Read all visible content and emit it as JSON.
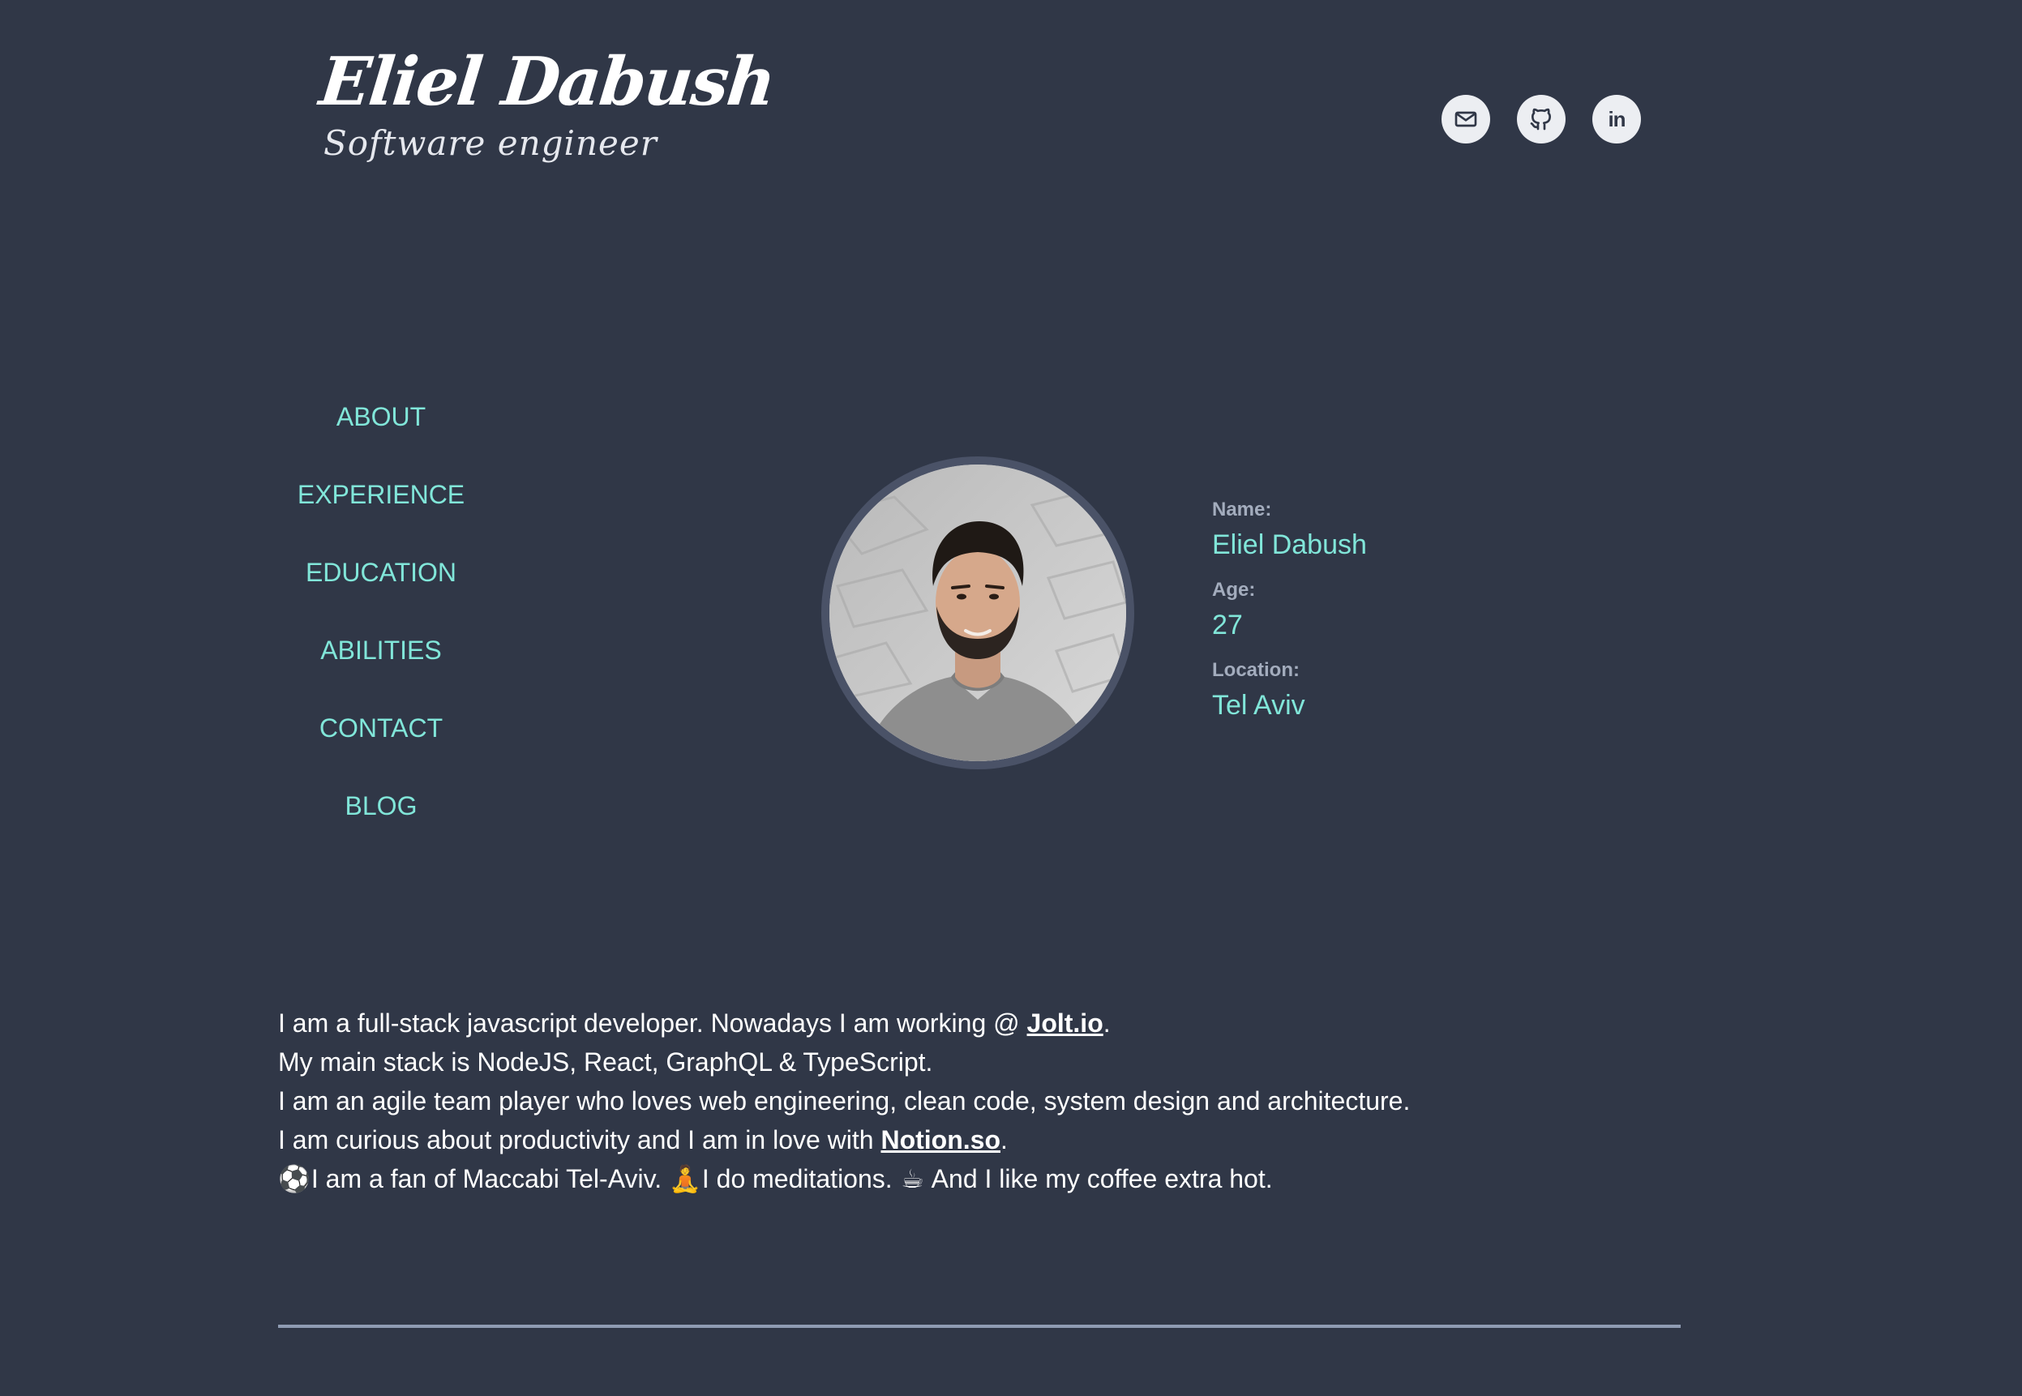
{
  "header": {
    "name": "Eliel Dabush",
    "tagline": "Software engineer"
  },
  "social": [
    {
      "name": "email",
      "icon": "mail-icon"
    },
    {
      "name": "github",
      "icon": "github-icon"
    },
    {
      "name": "linkedin",
      "icon": "linkedin-icon",
      "label": "in"
    }
  ],
  "nav": {
    "items": [
      "ABOUT",
      "EXPERIENCE",
      "EDUCATION",
      "ABILITIES",
      "CONTACT",
      "BLOG"
    ]
  },
  "profile": {
    "name_label": "Name:",
    "name_value": "Eliel Dabush",
    "age_label": "Age:",
    "age_value": "27",
    "location_label": "Location:",
    "location_value": "Tel Aviv"
  },
  "about": {
    "line1_pre": "I am a full-stack javascript developer. Nowadays I am working @ ",
    "line1_link": "Jolt.io",
    "line1_post": ".",
    "line2": "My main stack is NodeJS, React, GraphQL & TypeScript.",
    "line3": "I am an agile team player who loves web engineering, clean code, system design and architecture.",
    "line4_pre": "I am curious about productivity and I am in love with ",
    "line4_link": "Notion.so",
    "line4_post": ".",
    "line5_emoji1": "⚽",
    "line5_text1": " I am a fan of Maccabi Tel-Aviv. ",
    "line5_emoji2": "🧘",
    "line5_text2": " I do meditations. ",
    "line5_emoji3": "☕",
    "line5_text3": " And I like my coffee extra hot."
  },
  "colors": {
    "background": "#303747",
    "accent": "#81e6d9",
    "label": "#a3acbd",
    "divider": "#8f9cb3"
  }
}
